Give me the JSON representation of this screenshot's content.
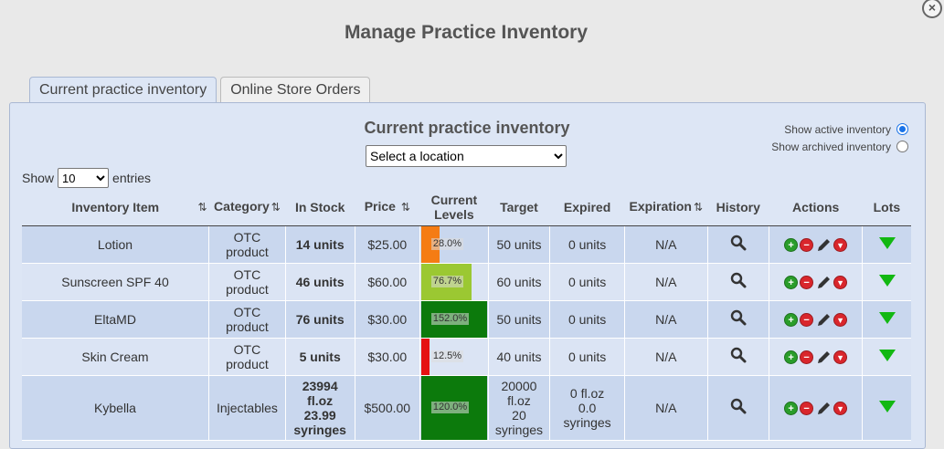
{
  "modal": {
    "title": "Manage Practice Inventory",
    "close_label": "×"
  },
  "tabs": [
    {
      "label": "Current practice inventory",
      "active": true
    },
    {
      "label": "Online Store Orders",
      "active": false
    }
  ],
  "panel": {
    "title": "Current practice inventory",
    "location_select": {
      "value": "Select a location"
    },
    "radios": [
      {
        "label": "Show active inventory",
        "checked": true
      },
      {
        "label": "Show archived inventory",
        "checked": false
      }
    ],
    "length": {
      "prefix": "Show",
      "value": "10",
      "suffix": "entries"
    }
  },
  "table": {
    "headers": {
      "item": "Inventory Item",
      "category": "Category",
      "in_stock": "In Stock",
      "price": "Price",
      "current_levels_1": "Current",
      "current_levels_2": "Levels",
      "target": "Target",
      "expired": "Expired",
      "expiration": "Expiration",
      "history": "History",
      "actions": "Actions",
      "lots": "Lots",
      "sort_glyph": "⇅"
    },
    "rows": [
      {
        "item": "Lotion",
        "category": [
          "OTC",
          "product"
        ],
        "in_stock": [
          "14 units"
        ],
        "price": "$25.00",
        "level_text": "28.0%",
        "level_fraction": 0.28,
        "level_color": "#f57c14",
        "target": [
          "50 units"
        ],
        "expired": [
          "0 units"
        ],
        "expiration": "N/A"
      },
      {
        "item": "Sunscreen SPF 40",
        "category": [
          "OTC",
          "product"
        ],
        "in_stock": [
          "46 units"
        ],
        "price": "$60.00",
        "level_text": "76.7%",
        "level_fraction": 0.767,
        "level_color": "#9bc832",
        "target": [
          "60 units"
        ],
        "expired": [
          "0 units"
        ],
        "expiration": "N/A"
      },
      {
        "item": "EltaMD",
        "category": [
          "OTC",
          "product"
        ],
        "in_stock": [
          "76 units"
        ],
        "price": "$30.00",
        "level_text": "152.0%",
        "level_fraction": 1.0,
        "level_color": "#0c7a0c",
        "target": [
          "50 units"
        ],
        "expired": [
          "0 units"
        ],
        "expiration": "N/A"
      },
      {
        "item": "Skin Cream",
        "category": [
          "OTC",
          "product"
        ],
        "in_stock": [
          "5 units"
        ],
        "price": "$30.00",
        "level_text": "12.5%",
        "level_fraction": 0.125,
        "level_color": "#e51212",
        "target": [
          "40 units"
        ],
        "expired": [
          "0 units"
        ],
        "expiration": "N/A"
      },
      {
        "item": "Kybella",
        "category": [
          "Injectables"
        ],
        "in_stock": [
          "23994",
          "fl.oz",
          "23.99",
          "syringes"
        ],
        "price": "$500.00",
        "level_text": "120.0%",
        "level_fraction": 1.0,
        "level_color": "#0c7a0c",
        "target": [
          "20000",
          "fl.oz",
          "20",
          "syringes"
        ],
        "expired": [
          "0 fl.oz",
          "0.0",
          "syringes"
        ],
        "expiration": "N/A"
      }
    ]
  },
  "colors": {
    "panel_bg": "#dde6f5",
    "row_odd": "#c9d7ee",
    "row_even": "#dbe4f4",
    "add_icon": "#2a9d2a",
    "remove_icon": "#d9262c",
    "lots_arrow": "#12b812"
  },
  "icons": {
    "history": "magnifier-icon",
    "add": "plus-circle-icon",
    "remove": "minus-circle-icon",
    "edit": "pencil-icon",
    "archive": "down-arrow-circle-icon",
    "lots": "green-triangle-down-icon",
    "close": "close-circle-icon"
  }
}
